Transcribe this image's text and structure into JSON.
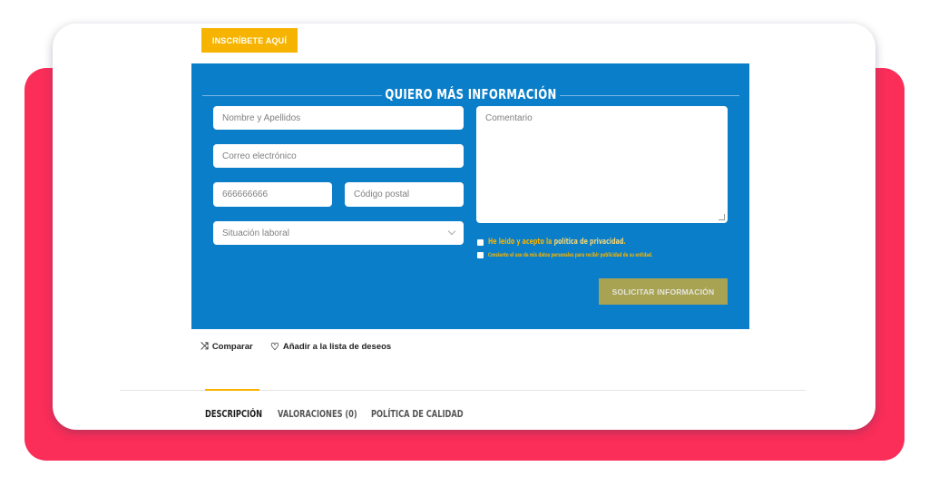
{
  "enroll_button": "INSCRÍBETE AQUÍ",
  "form": {
    "title": "QUIERO MÁS INFORMACIÓN",
    "name_placeholder": "Nombre y Apellidos",
    "email_placeholder": "Correo electrónico",
    "phone_placeholder": "666666666",
    "postal_placeholder": "Código postal",
    "employment_placeholder": "Situación laboral",
    "comment_placeholder": "Comentario",
    "privacy_prefix": "He leído y acepto la ",
    "privacy_link": "política de privacidad",
    "privacy_suffix": ".",
    "consent_label": "Consiento el uso de mis datos personales para recibir publicidad de su entidad.",
    "submit_label": "SOLICITAR INFORMACIÓN"
  },
  "actions": {
    "compare": "Comparar",
    "wishlist": "Añadir a la lista de deseos"
  },
  "tabs": [
    {
      "label": "DESCRIPCIÓN",
      "active": true
    },
    {
      "label": "VALORACIONES (0)",
      "active": false
    },
    {
      "label": "POLÍTICA DE CALIDAD",
      "active": false
    }
  ],
  "colors": {
    "accent_red": "#fb2d59",
    "form_blue": "#0b7ec9",
    "brand_yellow": "#f6b400",
    "submit_olive": "#a8a253"
  }
}
